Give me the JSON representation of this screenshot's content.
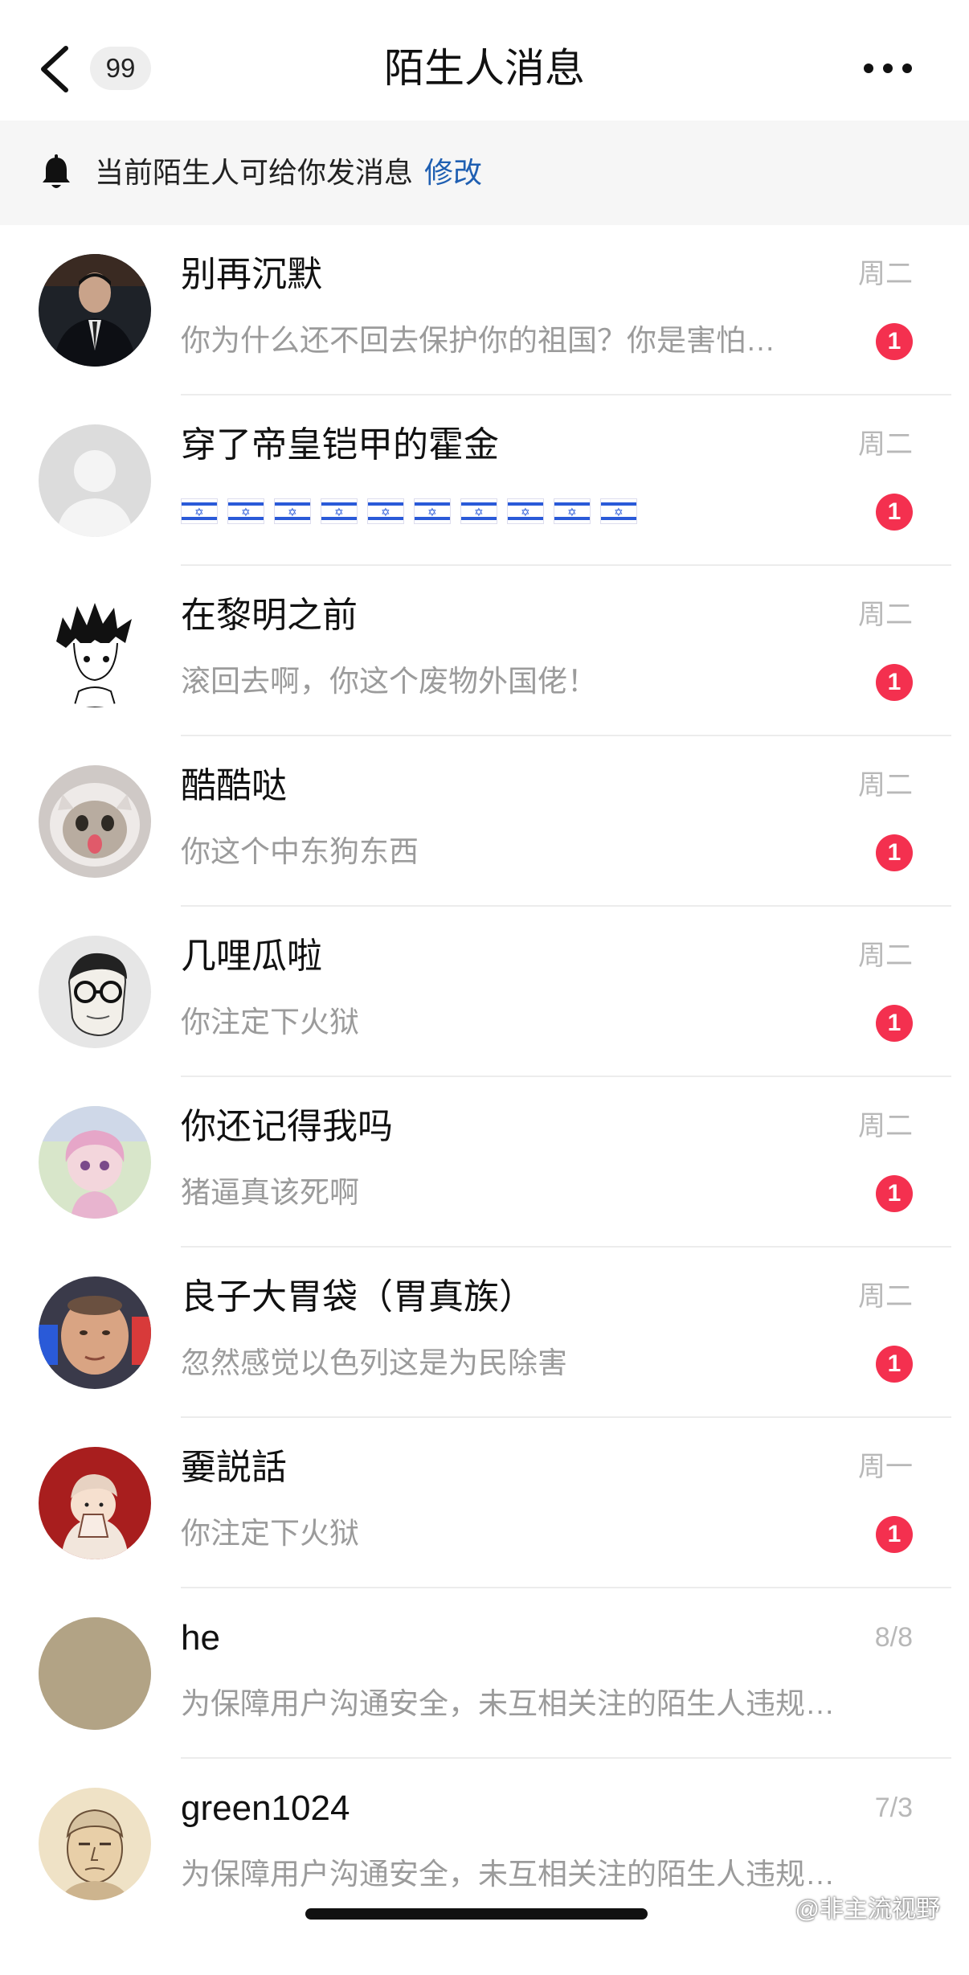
{
  "header": {
    "title": "陌生人消息",
    "unread_count": "99",
    "back_icon": "chevron-left-icon",
    "more_icon": "more-horizontal-icon"
  },
  "notice": {
    "icon": "bell-icon",
    "text": "当前陌生人可给你发消息",
    "link": "修改",
    "link_color": "#1f5fb2"
  },
  "messages": [
    {
      "name": "别再沉默",
      "time": "周二",
      "preview": "你为什么还不回去保护你的祖国？你是害怕…",
      "unread": "1"
    },
    {
      "name": "穿了帝皇铠甲的霍金",
      "time": "周二",
      "preview": "🇮🇱🇮🇱🇮🇱🇮🇱🇮🇱🇮🇱🇮🇱🇮🇱🇮🇱🇮🇱",
      "unread": "1"
    },
    {
      "name": "在黎明之前",
      "time": "周二",
      "preview": "滚回去啊，你这个废物外国佬！",
      "unread": "1"
    },
    {
      "name": "酷酷哒",
      "time": "周二",
      "preview": "你这个中东狗东西",
      "unread": "1"
    },
    {
      "name": "几哩瓜啦",
      "time": "周二",
      "preview": "你注定下火狱",
      "unread": "1"
    },
    {
      "name": "你还记得我吗",
      "time": "周二",
      "preview": "猪逼真该死啊",
      "unread": "1"
    },
    {
      "name": "良子大胃袋（胃真族）",
      "time": "周二",
      "preview": "忽然感觉以色列这是为民除害",
      "unread": "1"
    },
    {
      "name": "嫑説話",
      "time": "周一",
      "preview": "你注定下火狱",
      "unread": "1"
    },
    {
      "name": "he",
      "time": "8/8",
      "preview": "为保障用户沟通安全，未互相关注的陌生人违规…"
    },
    {
      "name": "green1024",
      "time": "7/3",
      "preview": "为保障用户沟通安全，未互相关注的陌生人违规…"
    }
  ],
  "watermark": "@非主流视野",
  "colors": {
    "badge": "#f4304f",
    "notice_bg": "#f6f6f6",
    "secondary_text": "#9b9b9b",
    "time_text": "#b8b8b8"
  }
}
